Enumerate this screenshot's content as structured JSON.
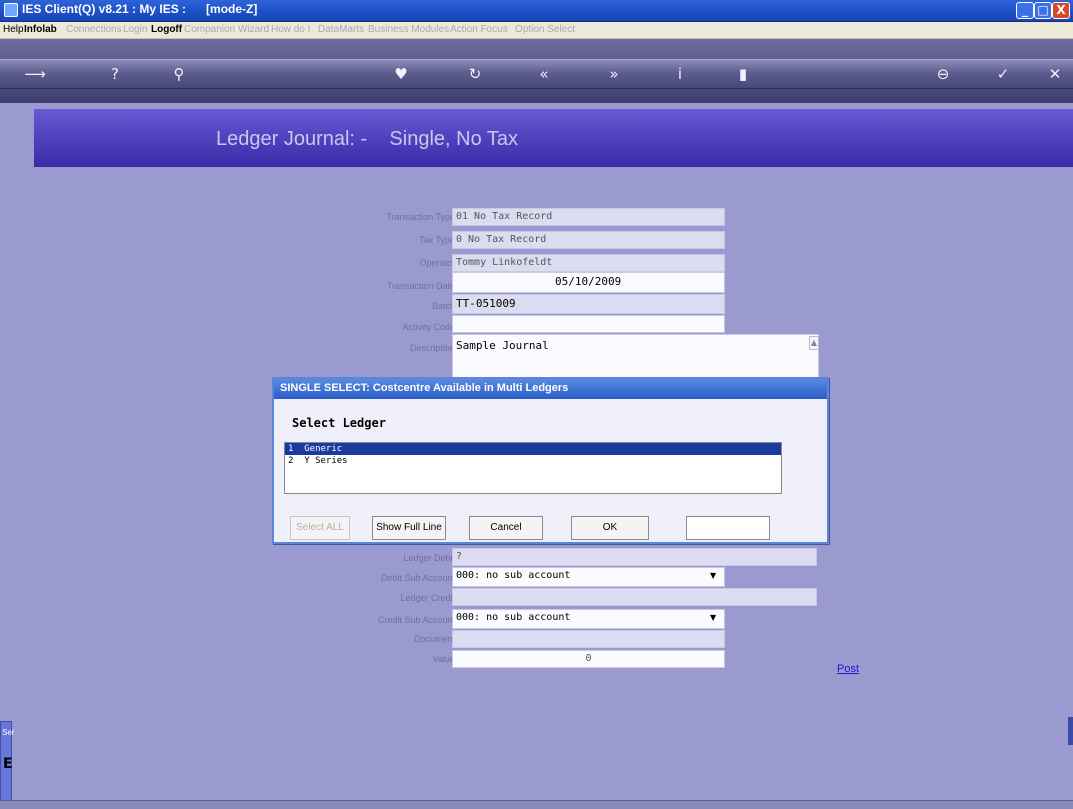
{
  "window": {
    "title": "IES Client(Q) v8.21 : My IES :      [mode-Z]",
    "minimize": "_",
    "maximize": "□",
    "close": "X"
  },
  "menu": {
    "items": [
      "Help",
      "Infolab",
      "Connections",
      "Login",
      "Logoff",
      "Companion",
      "Wizard",
      "How do I",
      "DataMarts",
      "Business Modules",
      "Action Focus",
      "Option Select"
    ]
  },
  "toolbar": {
    "icons": [
      "back-arrow-icon",
      "help-icon",
      "search-icon",
      "heart-icon",
      "refresh-icon",
      "rewind-icon",
      "forward-icon",
      "info-icon",
      "bookmark-icon",
      "minus-icon",
      "check-icon",
      "close-icon"
    ]
  },
  "header": {
    "title": "Ledger Journal: -    Single, No Tax"
  },
  "form": {
    "transaction_type": {
      "label": "Transaction Type",
      "value": "01 No Tax Record"
    },
    "tax_type": {
      "label": "Tax Type",
      "value": "0 No Tax Record"
    },
    "operator": {
      "label": "Operator",
      "value": "Tommy Linkofeldt"
    },
    "transaction_date": {
      "label": "Transaction Date",
      "value": "05/10/2009"
    },
    "batch": {
      "label": "Batch",
      "value": "TT-051009"
    },
    "activity_code": {
      "label": "Activity Code",
      "value": ""
    },
    "description": {
      "label": "Description",
      "value": "Sample Journal"
    },
    "ledger_debit": {
      "label": "Ledger Debit",
      "value": "?"
    },
    "debit_sub_account": {
      "label": "Debit Sub Account",
      "value": "000: no sub account"
    },
    "ledger_credit": {
      "label": "Ledger Credit",
      "value": ""
    },
    "credit_sub_account": {
      "label": "Credit Sub Account",
      "value": "000: no sub account"
    },
    "document": {
      "label": "Document",
      "value": ""
    },
    "value": {
      "label": "Value",
      "value": "0"
    }
  },
  "post_label": "Post",
  "dialog": {
    "title": "SINGLE SELECT: Costcentre Available in Multi Ledgers",
    "heading": "Select Ledger",
    "items": [
      "1  Generic",
      "2  Y Series"
    ],
    "buttons": {
      "select_all": "Select ALL",
      "show_full_line": "Show Full Line",
      "cancel": "Cancel",
      "ok": "OK"
    }
  },
  "side_tab": {
    "label": "Ser",
    "letter": "E"
  },
  "colors": {
    "background": "#9a9ad0",
    "header": "#4a3ab8",
    "titlebar": "#2a5cd0",
    "selected_row": "#1a3aa0"
  }
}
